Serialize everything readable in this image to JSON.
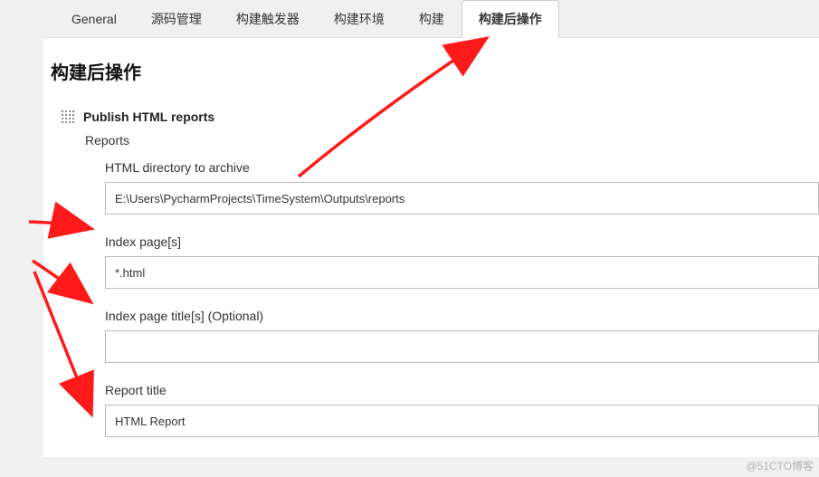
{
  "tabs": [
    {
      "label": "General"
    },
    {
      "label": "源码管理"
    },
    {
      "label": "构建触发器"
    },
    {
      "label": "构建环境"
    },
    {
      "label": "构建"
    },
    {
      "label": "构建后操作"
    }
  ],
  "section": {
    "title": "构建后操作"
  },
  "step": {
    "title": "Publish HTML reports",
    "reports_label": "Reports"
  },
  "fields": {
    "html_dir": {
      "label": "HTML directory to archive",
      "value": "E:\\Users\\PycharmProjects\\TimeSystem\\Outputs\\reports"
    },
    "index_pages": {
      "label": "Index page[s]",
      "value": "*.html"
    },
    "index_titles": {
      "label": "Index page title[s] (Optional)",
      "value": ""
    },
    "report_title": {
      "label": "Report title",
      "value": "HTML Report"
    }
  },
  "watermark": "@51CTO博客"
}
